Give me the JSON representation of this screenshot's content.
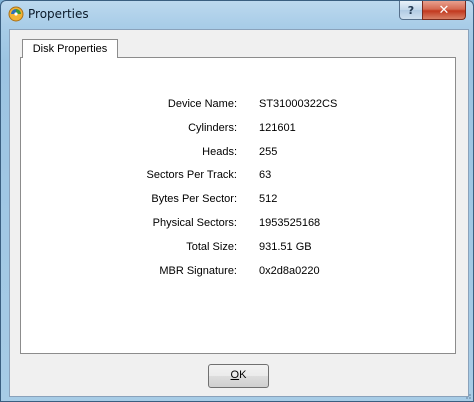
{
  "window": {
    "title": "Properties",
    "help_label": "?",
    "close_label": "✕"
  },
  "tabs": [
    {
      "label": "Disk Properties",
      "selected": true
    }
  ],
  "properties": [
    {
      "label": "Device Name:",
      "value": "ST31000322CS"
    },
    {
      "label": "Cylinders:",
      "value": "121601"
    },
    {
      "label": "Heads:",
      "value": "255"
    },
    {
      "label": "Sectors Per Track:",
      "value": "63"
    },
    {
      "label": "Bytes Per Sector:",
      "value": "512"
    },
    {
      "label": "Physical Sectors:",
      "value": "1953525168"
    },
    {
      "label": "Total Size:",
      "value": "931.51 GB"
    },
    {
      "label": "MBR Signature:",
      "value": "0x2d8a0220"
    }
  ],
  "buttons": {
    "ok_mnemonic": "O",
    "ok_rest": "K"
  },
  "colors": {
    "frame": "#a9cde8",
    "close": "#c2391f",
    "client": "#f0f0f0"
  },
  "icons": {
    "app": "disk-tool-icon",
    "help": "help-icon",
    "close": "close-icon",
    "resize": "resize-grip-icon"
  }
}
